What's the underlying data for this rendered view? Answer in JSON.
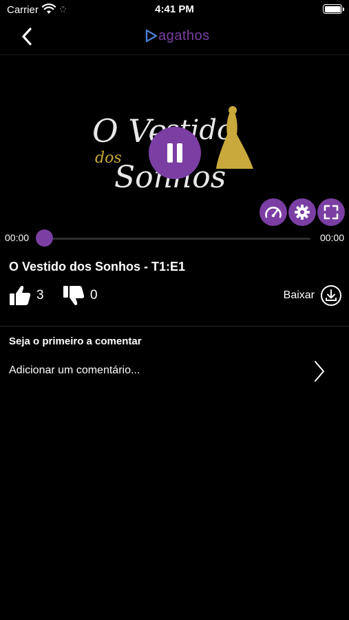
{
  "status_bar": {
    "carrier": "Carrier",
    "time": "4:41 PM"
  },
  "nav": {
    "back_icon": "chevron-left-icon",
    "logo_text": "agathos",
    "logo_color": "#7b3fa3"
  },
  "player": {
    "art_text": "O Vestido dos Sonhos",
    "pause_icon": "pause-icon",
    "controls": [
      "speedometer-icon",
      "gear-icon",
      "fullscreen-icon"
    ],
    "current_time": "00:00",
    "total_time": "00:00",
    "progress": 0,
    "accent_color": "#7b3fa3"
  },
  "episode": {
    "title": "O Vestido dos Sonhos - T1:E1",
    "likes": "3",
    "dislikes": "0",
    "download_label": "Baixar"
  },
  "comments": {
    "heading": "Seja o primeiro a comentar",
    "add_placeholder": "Adicionar um comentário..."
  }
}
